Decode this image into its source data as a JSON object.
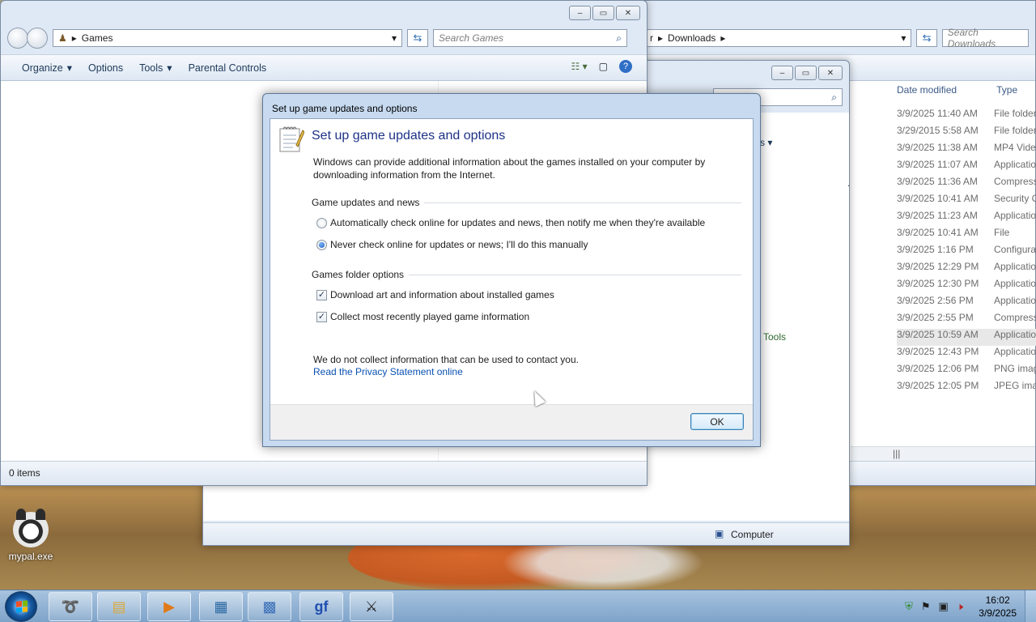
{
  "desktop": {
    "icon_label": "mypal.exe"
  },
  "games_window": {
    "address_segment": "Games",
    "search_placeholder": "Search Games",
    "toolbar": [
      "Organize",
      "Options",
      "Tools",
      "Parental Controls"
    ],
    "status_text": "0 items"
  },
  "downloads_window": {
    "address_partial": "r",
    "address_segment": "Downloads",
    "search_placeholder": "Search Downloads",
    "columns": {
      "date": "Date modified",
      "type": "Type"
    },
    "partial_name_visible": "zip",
    "rows": [
      {
        "date": "3/9/2025 11:40 AM",
        "type": "File folder"
      },
      {
        "date": "3/29/2015 5:58 AM",
        "type": "File folder"
      },
      {
        "date": "3/9/2025 11:38 AM",
        "type": "MP4 Video"
      },
      {
        "date": "3/9/2025 11:07 AM",
        "type": "Application"
      },
      {
        "date": "3/9/2025 11:36 AM",
        "type": "Compressed"
      },
      {
        "date": "3/9/2025 10:41 AM",
        "type": "Security Certificate"
      },
      {
        "date": "3/9/2025 11:23 AM",
        "type": "Application"
      },
      {
        "date": "3/9/2025 10:41 AM",
        "type": "File"
      },
      {
        "date": "3/9/2025 1:16 PM",
        "type": "Configuration"
      },
      {
        "date": "3/9/2025 12:29 PM",
        "type": "Application"
      },
      {
        "date": "3/9/2025 12:30 PM",
        "type": "Application"
      },
      {
        "date": "3/9/2025 2:56 PM",
        "type": "Application"
      },
      {
        "date": "3/9/2025 2:55 PM",
        "type": "Compressed"
      },
      {
        "date": "3/9/2025 10:59 AM",
        "type": "Application"
      },
      {
        "date": "3/9/2025 12:43 PM",
        "type": "Application"
      },
      {
        "date": "3/9/2025 12:06 PM",
        "type": "PNG image"
      },
      {
        "date": "3/9/2025 12:05 PM",
        "type": "JPEG image"
      }
    ]
  },
  "computer_window": {
    "status_label": "Computer",
    "partial_link": "Tools"
  },
  "dialog": {
    "title": "Set up game updates and options",
    "heading": "Set up game updates and options",
    "description": "Windows can provide additional information about the games installed on your computer by downloading information from the Internet.",
    "updates_group": "Game updates and news",
    "radio_auto": "Automatically check online for updates and news, then notify me when they're available",
    "radio_never": "Never check online for updates or news; I'll do this manually",
    "selected_radio": "never",
    "folder_group": "Games folder options",
    "check_art": "Download art and information about installed games",
    "check_art_checked": true,
    "check_recent": "Collect most recently played game information",
    "check_recent_checked": true,
    "privacy_text": "We do not collect information that can be used to contact you.",
    "privacy_link": "Read the Privacy Statement online",
    "ok_label": "OK"
  },
  "taskbar": {
    "time": "16:02",
    "date": "3/9/2025"
  },
  "colors": {
    "link": "#0a52b3",
    "heading": "#1e3287",
    "taskbar": "#9fbcd9"
  }
}
